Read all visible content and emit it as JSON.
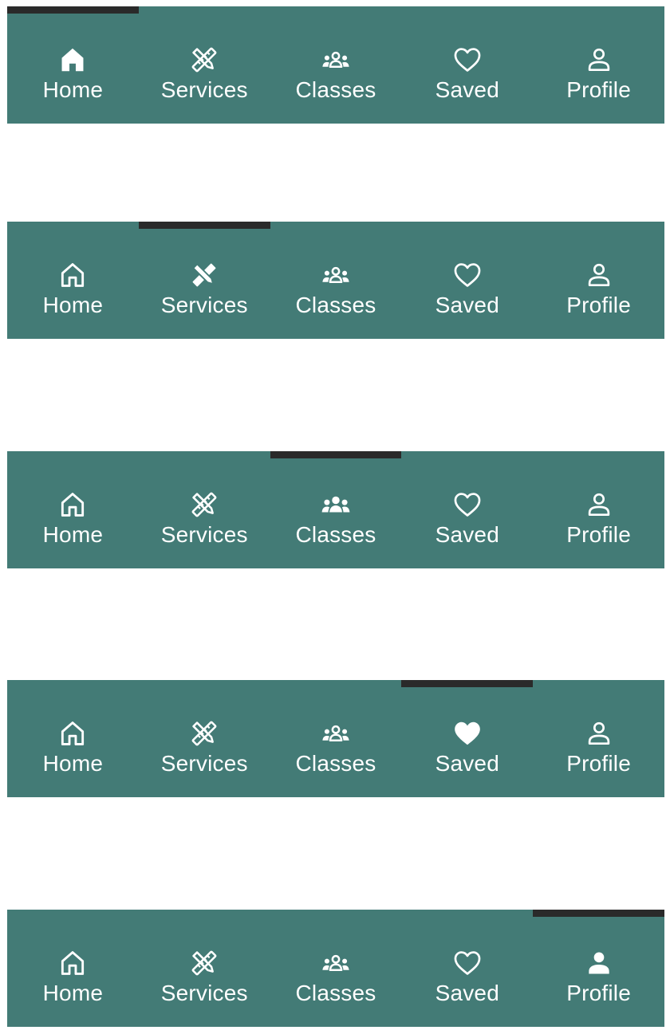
{
  "theme": {
    "bar_color": "#437b76",
    "indicator_color": "#2a2a2a",
    "text_color": "#ffffff"
  },
  "states": [
    {
      "active": 0,
      "items": [
        {
          "label": "Home",
          "icon": "home-icon"
        },
        {
          "label": "Services",
          "icon": "tools-icon"
        },
        {
          "label": "Classes",
          "icon": "people-group-icon"
        },
        {
          "label": "Saved",
          "icon": "heart-icon"
        },
        {
          "label": "Profile",
          "icon": "person-icon"
        }
      ]
    },
    {
      "active": 1,
      "items": [
        {
          "label": "Home",
          "icon": "home-icon"
        },
        {
          "label": "Services",
          "icon": "tools-icon"
        },
        {
          "label": "Classes",
          "icon": "people-group-icon"
        },
        {
          "label": "Saved",
          "icon": "heart-icon"
        },
        {
          "label": "Profile",
          "icon": "person-icon"
        }
      ]
    },
    {
      "active": 2,
      "items": [
        {
          "label": "Home",
          "icon": "home-icon"
        },
        {
          "label": "Services",
          "icon": "tools-icon"
        },
        {
          "label": "Classes",
          "icon": "people-group-icon"
        },
        {
          "label": "Saved",
          "icon": "heart-icon"
        },
        {
          "label": "Profile",
          "icon": "person-icon"
        }
      ]
    },
    {
      "active": 3,
      "items": [
        {
          "label": "Home",
          "icon": "home-icon"
        },
        {
          "label": "Services",
          "icon": "tools-icon"
        },
        {
          "label": "Classes",
          "icon": "people-group-icon"
        },
        {
          "label": "Saved",
          "icon": "heart-icon"
        },
        {
          "label": "Profile",
          "icon": "person-icon"
        }
      ]
    },
    {
      "active": 4,
      "items": [
        {
          "label": "Home",
          "icon": "home-icon"
        },
        {
          "label": "Services",
          "icon": "tools-icon"
        },
        {
          "label": "Classes",
          "icon": "people-group-icon"
        },
        {
          "label": "Saved",
          "icon": "heart-icon"
        },
        {
          "label": "Profile",
          "icon": "person-icon"
        }
      ]
    }
  ]
}
